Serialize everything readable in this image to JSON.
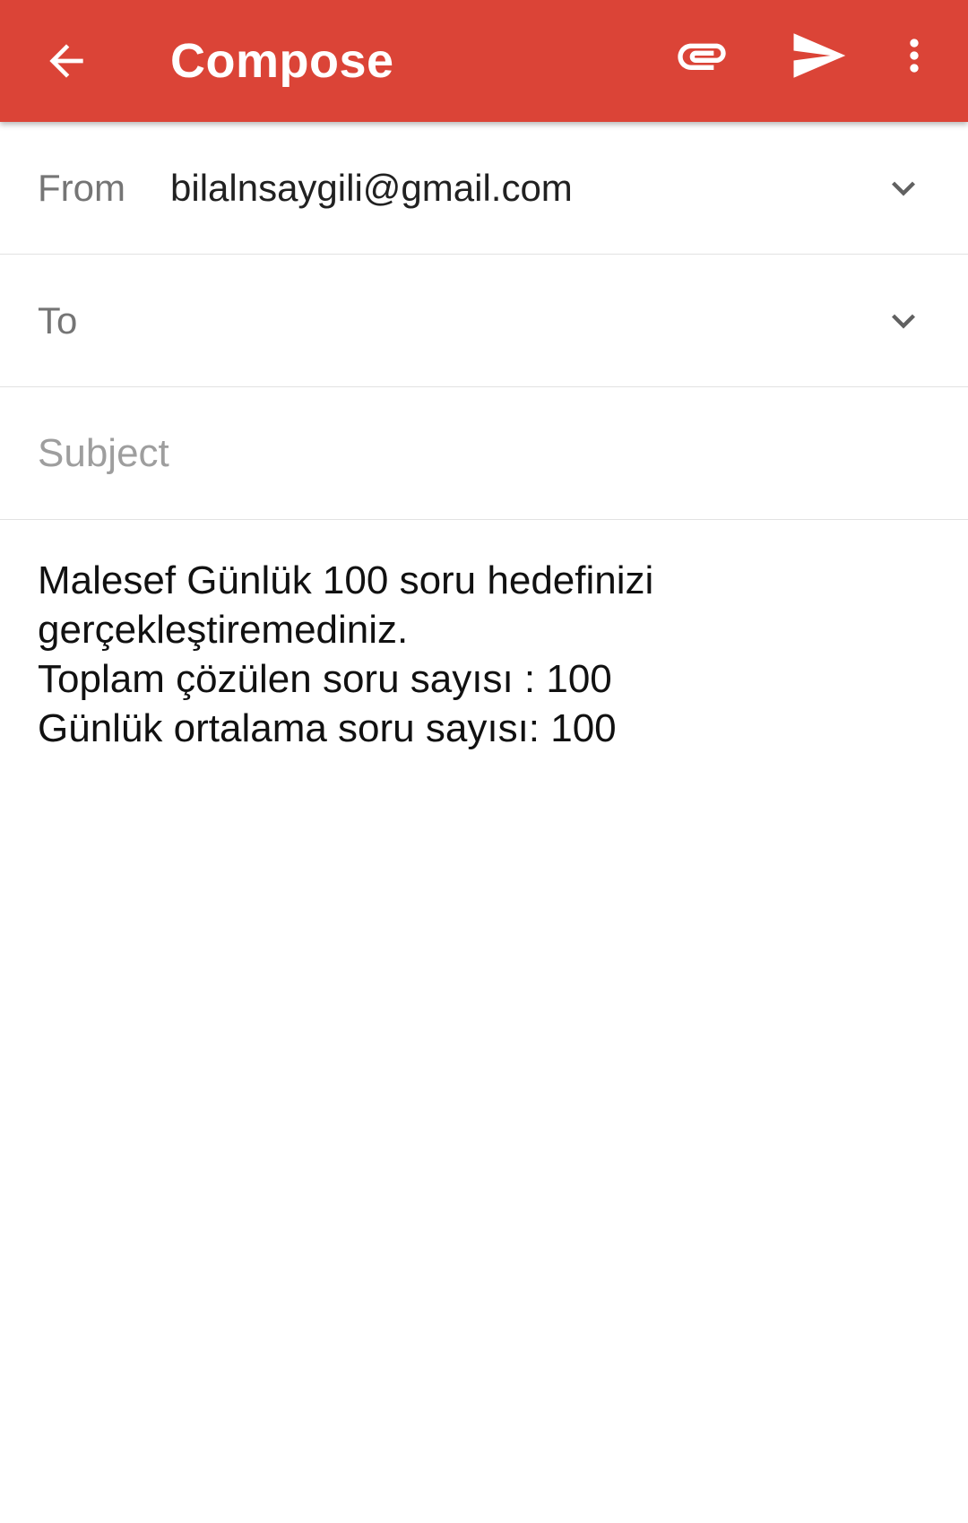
{
  "app_bar": {
    "title": "Compose",
    "background_color": "#db4437",
    "icons": {
      "back": "back-arrow-icon",
      "attach": "paperclip-icon",
      "send": "send-icon",
      "more": "more-vert-icon"
    }
  },
  "from": {
    "label": "From",
    "value": "bilalnsaygili@gmail.com"
  },
  "to": {
    "label": "To",
    "value": ""
  },
  "subject": {
    "placeholder": "Subject",
    "value": ""
  },
  "body": {
    "lines": [
      "Malesef Günlük 100 soru hedefinizi",
      "gerçekleştiremediniz.",
      "Toplam çözülen soru sayısı : 100",
      "Günlük ortalama soru sayısı: 100"
    ]
  }
}
